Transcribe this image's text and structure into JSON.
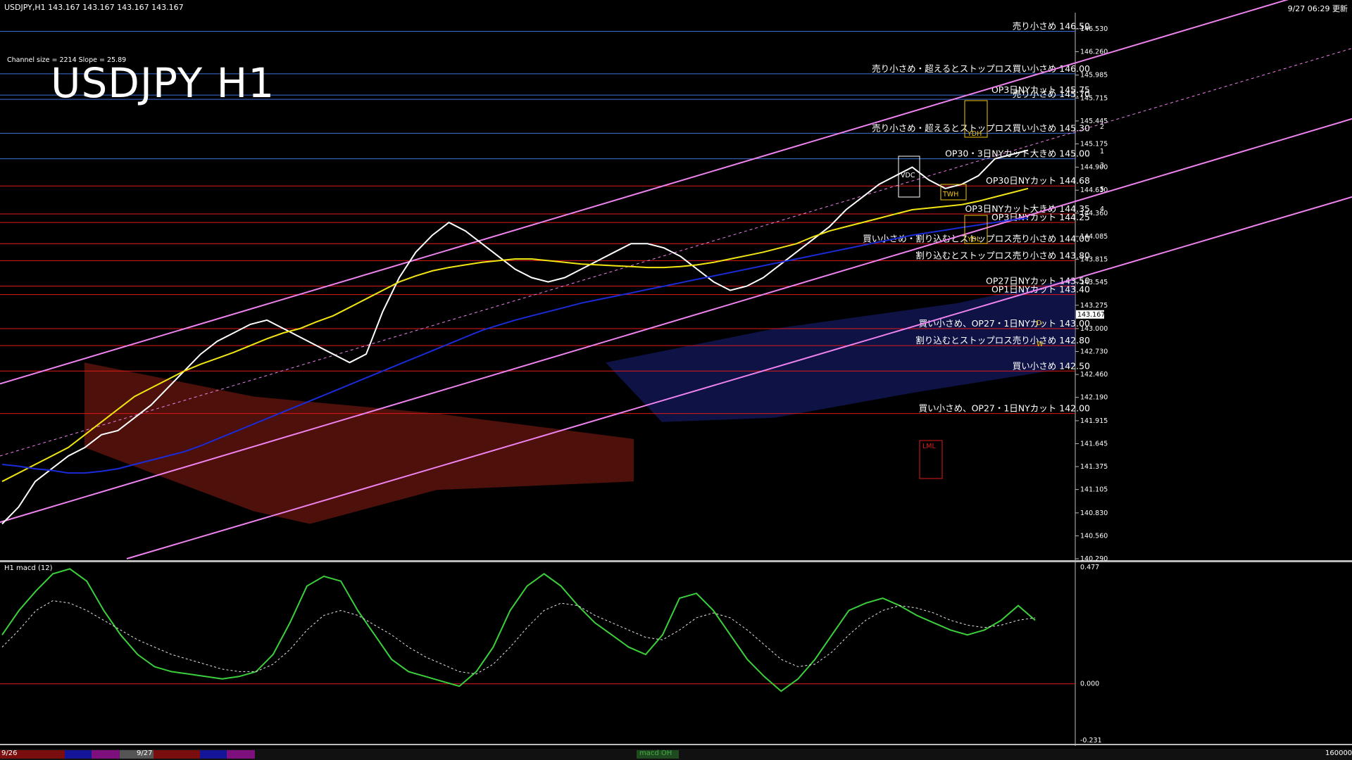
{
  "header": {
    "symbol_info": "USDJPY,H1  143.167 143.167 143.167 143.167",
    "update_time": "9/27 06:29 更新",
    "channel_info": "Channel size = 2214 Slope = 25.89",
    "title": "USDJPY H1"
  },
  "levels": [
    {
      "label": "売り小さめ 146.50",
      "price": 146.5,
      "color": "#3f6fd8"
    },
    {
      "label": "売り小さめ・超えるとストップロス買い小さめ 146.00",
      "price": 146.0,
      "color": "#3f6fd8"
    },
    {
      "label": "OP3日NYカット 145.75",
      "price": 145.75,
      "color": "#3f6fd8"
    },
    {
      "label": "売り小さめ 145.70",
      "price": 145.7,
      "color": "#3f6fd8"
    },
    {
      "label": "売り小さめ・超えるとストップロス買い小さめ 145.30",
      "price": 145.3,
      "color": "#3f6fd8"
    },
    {
      "label": "OP30・3日NYカット大きめ 145.00",
      "price": 145.0,
      "color": "#3f6fd8"
    },
    {
      "label": "OP30日NYカット 144.68",
      "price": 144.68,
      "color": "#e11a1a"
    },
    {
      "label": "OP3日NYカット大きめ 144.35",
      "price": 144.35,
      "color": "#e11a1a"
    },
    {
      "label": "OP3日NYカット 144.25",
      "price": 144.25,
      "color": "#e11a1a"
    },
    {
      "label": "買い小さめ・割り込むとストップロス売り小さめ 144.00",
      "price": 144.0,
      "color": "#e11a1a"
    },
    {
      "label": "割り込むとストップロス売り小さめ 143.80",
      "price": 143.8,
      "color": "#e11a1a"
    },
    {
      "label": "OP27日NYカット 143.50",
      "price": 143.5,
      "color": "#e11a1a"
    },
    {
      "label": "OP1日NYカット 143.40",
      "price": 143.4,
      "color": "#e11a1a"
    },
    {
      "label": "買い小さめ、OP27・1日NYカット 143.00",
      "price": 143.0,
      "color": "#e11a1a"
    },
    {
      "label": "割り込むとストップロス売り小さめ 142.80",
      "price": 142.8,
      "color": "#e11a1a"
    },
    {
      "label": "買い小さめ 142.50",
      "price": 142.5,
      "color": "#e11a1a"
    },
    {
      "label": "買い小さめ、OP27・1日NYカット 142.00",
      "price": 142.0,
      "color": "#e11a1a"
    }
  ],
  "chart_data": [
    {
      "type": "line",
      "title": "USDJPY H1",
      "ylim": [
        140.29,
        146.8
      ],
      "y_ticks": [
        146.53,
        146.26,
        145.985,
        145.715,
        145.445,
        145.175,
        144.9,
        144.63,
        144.36,
        144.085,
        143.815,
        143.545,
        143.275,
        143.0,
        142.73,
        142.46,
        142.19,
        141.915,
        141.645,
        141.375,
        141.105,
        140.83,
        140.56,
        140.29
      ],
      "current_price": "143.167",
      "x_labels": [
        "9/26",
        "9/27"
      ],
      "series": [
        {
          "values": [
            140.7,
            140.9,
            141.2,
            141.35,
            141.5,
            141.6,
            141.75,
            141.8,
            141.95,
            142.1,
            142.3,
            142.5,
            142.7,
            142.85,
            142.95,
            143.05,
            143.1,
            143.0,
            142.9,
            142.8,
            142.7,
            142.6,
            142.7,
            143.2,
            143.6,
            143.9,
            144.1,
            144.25,
            144.15,
            144.0,
            143.85,
            143.7,
            143.6,
            143.55,
            143.6,
            143.7,
            143.8,
            143.9,
            144.0,
            144.0,
            143.95,
            143.85,
            143.7,
            143.55,
            143.45,
            143.5,
            143.6,
            143.75,
            143.9,
            144.05,
            144.2,
            144.4,
            144.55,
            144.7,
            144.8,
            144.9,
            144.75,
            144.65,
            144.7,
            144.8,
            145.0,
            145.05,
            145.1
          ]
        },
        {
          "values": [
            141.2,
            141.3,
            141.4,
            141.5,
            141.6,
            141.75,
            141.9,
            142.05,
            142.2,
            142.3,
            142.4,
            142.5,
            142.58,
            142.65,
            142.72,
            142.8,
            142.88,
            142.95,
            143.0,
            143.08,
            143.15,
            143.25,
            143.35,
            143.45,
            143.55,
            143.62,
            143.68,
            143.72,
            143.75,
            143.78,
            143.8,
            143.82,
            143.82,
            143.8,
            143.78,
            143.76,
            143.75,
            143.74,
            143.73,
            143.72,
            143.72,
            143.73,
            143.75,
            143.78,
            143.82,
            143.86,
            143.9,
            143.95,
            144.0,
            144.08,
            144.15,
            144.2,
            144.25,
            144.3,
            144.35,
            144.4,
            144.42,
            144.44,
            144.46,
            144.5,
            144.55,
            144.6,
            144.65
          ]
        },
        {
          "values": [
            141.4,
            141.38,
            141.35,
            141.33,
            141.3,
            141.3,
            141.32,
            141.35,
            141.4,
            141.45,
            141.5,
            141.55,
            141.62,
            141.7,
            141.78,
            141.86,
            141.94,
            142.02,
            142.1,
            142.18,
            142.26,
            142.34,
            142.42,
            142.5,
            142.58,
            142.66,
            142.74,
            142.82,
            142.9,
            142.98,
            143.04,
            143.1,
            143.15,
            143.2,
            143.25,
            143.3,
            143.34,
            143.38,
            143.42,
            143.46,
            143.5,
            143.54,
            143.58,
            143.62,
            143.66,
            143.7,
            143.74,
            143.78,
            143.82,
            143.86,
            143.9,
            143.94,
            143.98,
            144.02,
            144.06,
            144.1,
            144.13,
            144.16,
            144.19,
            144.22,
            144.25,
            144.28,
            144.3
          ]
        }
      ]
    },
    {
      "type": "line",
      "title": "H1 macd (12)",
      "ylim": [
        -0.231,
        0.477
      ],
      "y_ticks": [
        0.477,
        0.0,
        -0.231
      ],
      "series": [
        {
          "values": [
            0.2,
            0.3,
            0.38,
            0.45,
            0.47,
            0.42,
            0.3,
            0.2,
            0.12,
            0.07,
            0.05,
            0.04,
            0.03,
            0.02,
            0.03,
            0.05,
            0.12,
            0.25,
            0.4,
            0.44,
            0.42,
            0.3,
            0.2,
            0.1,
            0.05,
            0.03,
            0.01,
            -0.01,
            0.05,
            0.15,
            0.3,
            0.4,
            0.45,
            0.4,
            0.32,
            0.25,
            0.2,
            0.15,
            0.12,
            0.2,
            0.35,
            0.37,
            0.3,
            0.2,
            0.1,
            0.03,
            -0.03,
            0.02,
            0.1,
            0.2,
            0.3,
            0.33,
            0.35,
            0.32,
            0.28,
            0.25,
            0.22,
            0.2,
            0.22,
            0.26,
            0.32,
            0.26
          ]
        },
        {
          "values": [
            0.15,
            0.22,
            0.3,
            0.34,
            0.33,
            0.3,
            0.26,
            0.22,
            0.18,
            0.15,
            0.12,
            0.1,
            0.08,
            0.06,
            0.05,
            0.05,
            0.08,
            0.14,
            0.22,
            0.28,
            0.3,
            0.28,
            0.24,
            0.2,
            0.15,
            0.11,
            0.08,
            0.05,
            0.04,
            0.08,
            0.15,
            0.23,
            0.3,
            0.33,
            0.32,
            0.28,
            0.25,
            0.22,
            0.19,
            0.18,
            0.22,
            0.27,
            0.29,
            0.27,
            0.22,
            0.16,
            0.1,
            0.07,
            0.08,
            0.13,
            0.2,
            0.26,
            0.3,
            0.32,
            0.31,
            0.29,
            0.26,
            0.24,
            0.23,
            0.24,
            0.26,
            0.27
          ]
        }
      ]
    }
  ],
  "macd_panel": {
    "label": "H1 macd (12)"
  },
  "bottom_bar": {
    "date1": "9/26",
    "date2": "9/27",
    "tab": "macd OH",
    "right_value": "160000"
  },
  "annotations": {
    "ydh": "YDH",
    "ydl": "YDL",
    "vdc": "VDC",
    "twh": "TWH",
    "lml": "LML",
    "d": "D",
    "w": "W",
    "n1": "1",
    "n2": "2",
    "n3": "3",
    "n4": "4",
    "n5": "5"
  }
}
